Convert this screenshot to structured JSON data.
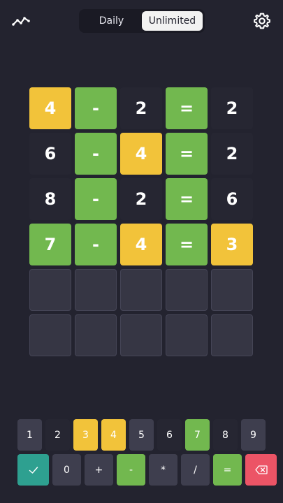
{
  "header": {
    "stats_icon": "stats-line-icon",
    "settings_icon": "gear-icon",
    "tabs": [
      {
        "label": "Daily",
        "active": false
      },
      {
        "label": "Unlimited",
        "active": true
      }
    ]
  },
  "colors": {
    "correct": "#72b84f",
    "present": "#f2c33a",
    "absent": "#262632",
    "empty": "#363644",
    "enter": "#2ea090",
    "delete": "#ec5466"
  },
  "board": {
    "rows": [
      [
        {
          "v": "4",
          "s": "present"
        },
        {
          "v": "-",
          "s": "correct"
        },
        {
          "v": "2",
          "s": "absent"
        },
        {
          "v": "=",
          "s": "correct"
        },
        {
          "v": "2",
          "s": "absent"
        }
      ],
      [
        {
          "v": "6",
          "s": "absent"
        },
        {
          "v": "-",
          "s": "correct"
        },
        {
          "v": "4",
          "s": "present"
        },
        {
          "v": "=",
          "s": "correct"
        },
        {
          "v": "2",
          "s": "absent"
        }
      ],
      [
        {
          "v": "8",
          "s": "absent"
        },
        {
          "v": "-",
          "s": "correct"
        },
        {
          "v": "2",
          "s": "absent"
        },
        {
          "v": "=",
          "s": "correct"
        },
        {
          "v": "6",
          "s": "absent"
        }
      ],
      [
        {
          "v": "7",
          "s": "correct"
        },
        {
          "v": "-",
          "s": "correct"
        },
        {
          "v": "4",
          "s": "present"
        },
        {
          "v": "=",
          "s": "correct"
        },
        {
          "v": "3",
          "s": "present"
        }
      ],
      [
        {
          "v": "",
          "s": "empty"
        },
        {
          "v": "",
          "s": "empty"
        },
        {
          "v": "",
          "s": "empty"
        },
        {
          "v": "",
          "s": "empty"
        },
        {
          "v": "",
          "s": "empty"
        }
      ],
      [
        {
          "v": "",
          "s": "empty"
        },
        {
          "v": "",
          "s": "empty"
        },
        {
          "v": "",
          "s": "empty"
        },
        {
          "v": "",
          "s": "empty"
        },
        {
          "v": "",
          "s": "empty"
        }
      ]
    ]
  },
  "keyboard": {
    "row1": [
      {
        "label": "1",
        "s": "unused"
      },
      {
        "label": "2",
        "s": "absent"
      },
      {
        "label": "3",
        "s": "present"
      },
      {
        "label": "4",
        "s": "present"
      },
      {
        "label": "5",
        "s": "unused"
      },
      {
        "label": "6",
        "s": "absent"
      },
      {
        "label": "7",
        "s": "correct"
      },
      {
        "label": "8",
        "s": "absent"
      },
      {
        "label": "9",
        "s": "unused"
      }
    ],
    "row2": [
      {
        "label": "",
        "s": "enter",
        "icon": "check-icon"
      },
      {
        "label": "0",
        "s": "unused"
      },
      {
        "label": "+",
        "s": "unused"
      },
      {
        "label": "-",
        "s": "correct"
      },
      {
        "label": "*",
        "s": "unused"
      },
      {
        "label": "/",
        "s": "unused"
      },
      {
        "label": "=",
        "s": "correct"
      },
      {
        "label": "",
        "s": "delete",
        "icon": "backspace-icon"
      }
    ]
  }
}
